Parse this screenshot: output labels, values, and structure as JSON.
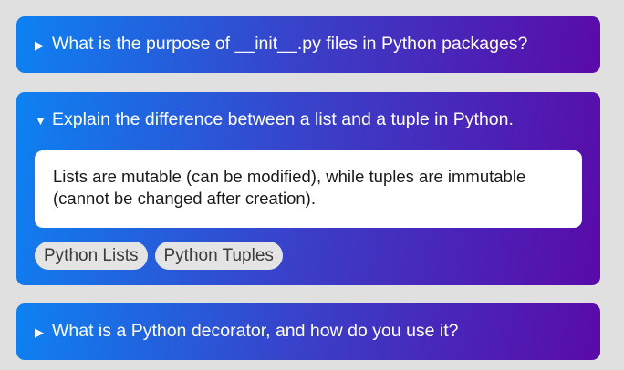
{
  "faqs": [
    {
      "question": "What is the purpose of __init__.py files in Python packages?",
      "marker": "▶",
      "expanded": false
    },
    {
      "question": "Explain the difference between a list and a tuple in Python.",
      "marker": "▼",
      "expanded": true,
      "answer": "Lists are mutable (can be modified), while tuples are immutable (cannot be changed after creation).",
      "tags": [
        "Python Lists",
        "Python Tuples"
      ]
    },
    {
      "question": "What is a Python decorator, and how do you use it?",
      "marker": "▶",
      "expanded": false
    }
  ],
  "colors": {
    "background": "#e0e0e0",
    "gradient_start": "#0d82f2",
    "gradient_end": "#5a0aa8",
    "answer_bg": "#ffffff",
    "tag_bg": "#e4e4e4"
  }
}
